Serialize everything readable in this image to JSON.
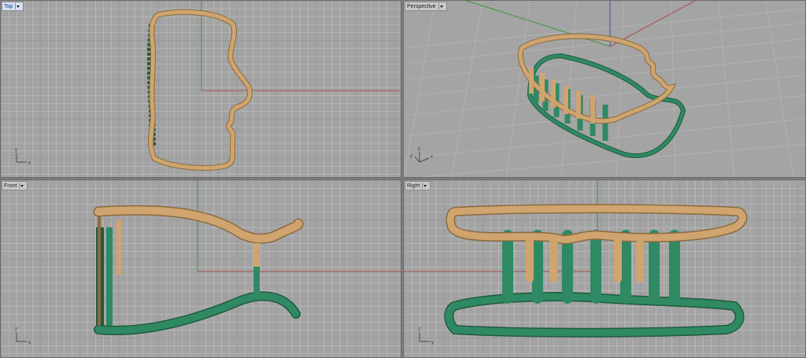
{
  "viewports": {
    "top": {
      "label": "Top",
      "active": true
    },
    "perspective": {
      "label": "Perspective",
      "active": false
    },
    "front": {
      "label": "Front",
      "active": false
    },
    "right": {
      "label": "Right",
      "active": false
    }
  },
  "axis_labels": {
    "top": [
      "y",
      "x"
    ],
    "perspective": [
      "z",
      "y",
      "x"
    ],
    "front": [
      "z",
      "x"
    ],
    "right": [
      "z",
      "y"
    ]
  },
  "colors": {
    "gold_part": "#cfa46e",
    "green_part": "#2f8a63",
    "x_axis": "#a85050",
    "y_axis": "#3a9a3a",
    "z_axis": "#4a4ab0",
    "grid_bg": "#a3a3a3"
  }
}
